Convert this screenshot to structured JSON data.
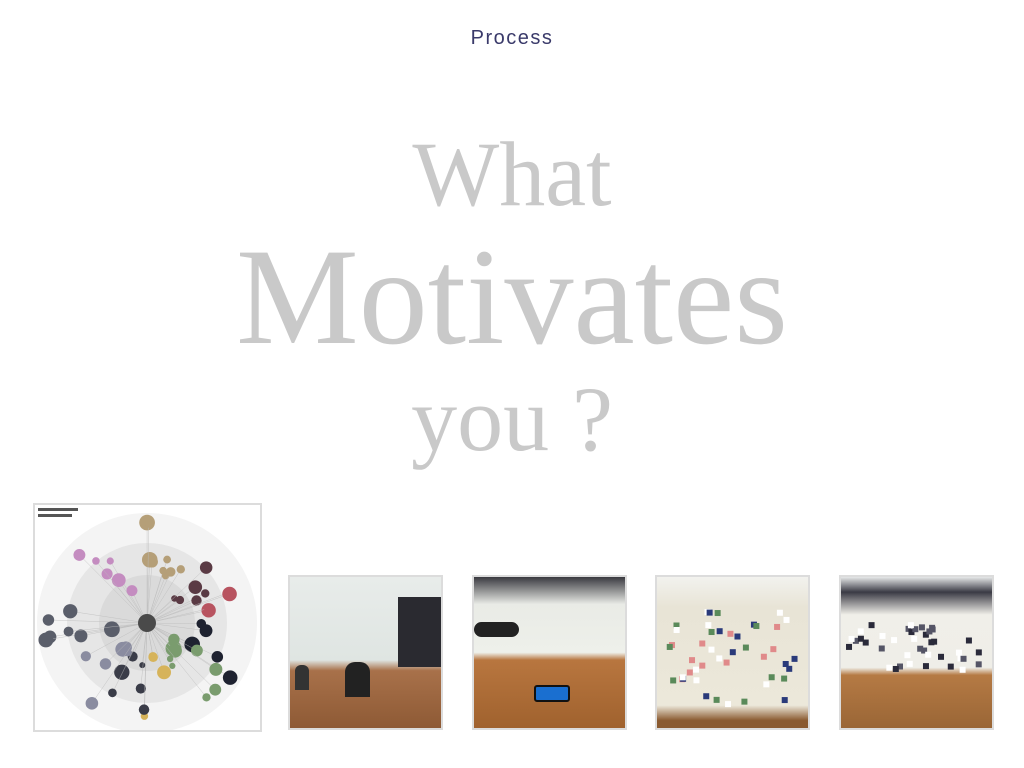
{
  "header": {
    "title": "Process"
  },
  "headline": {
    "line1": "What",
    "line2": "Motivates",
    "line3": "you ?"
  },
  "thumbnails": [
    {
      "kind": "diagram",
      "alt": "motivation-map-diagram"
    },
    {
      "kind": "photo",
      "alt": "meeting-room-photo"
    },
    {
      "kind": "photo",
      "alt": "drawing-on-paper-photo"
    },
    {
      "kind": "photo",
      "alt": "sticky-notes-map-photo"
    },
    {
      "kind": "photo",
      "alt": "placing-cards-photo"
    }
  ],
  "colors": {
    "header": "#3a3a6a",
    "headline": "#c9c9c9",
    "border": "#dcdcdc"
  }
}
